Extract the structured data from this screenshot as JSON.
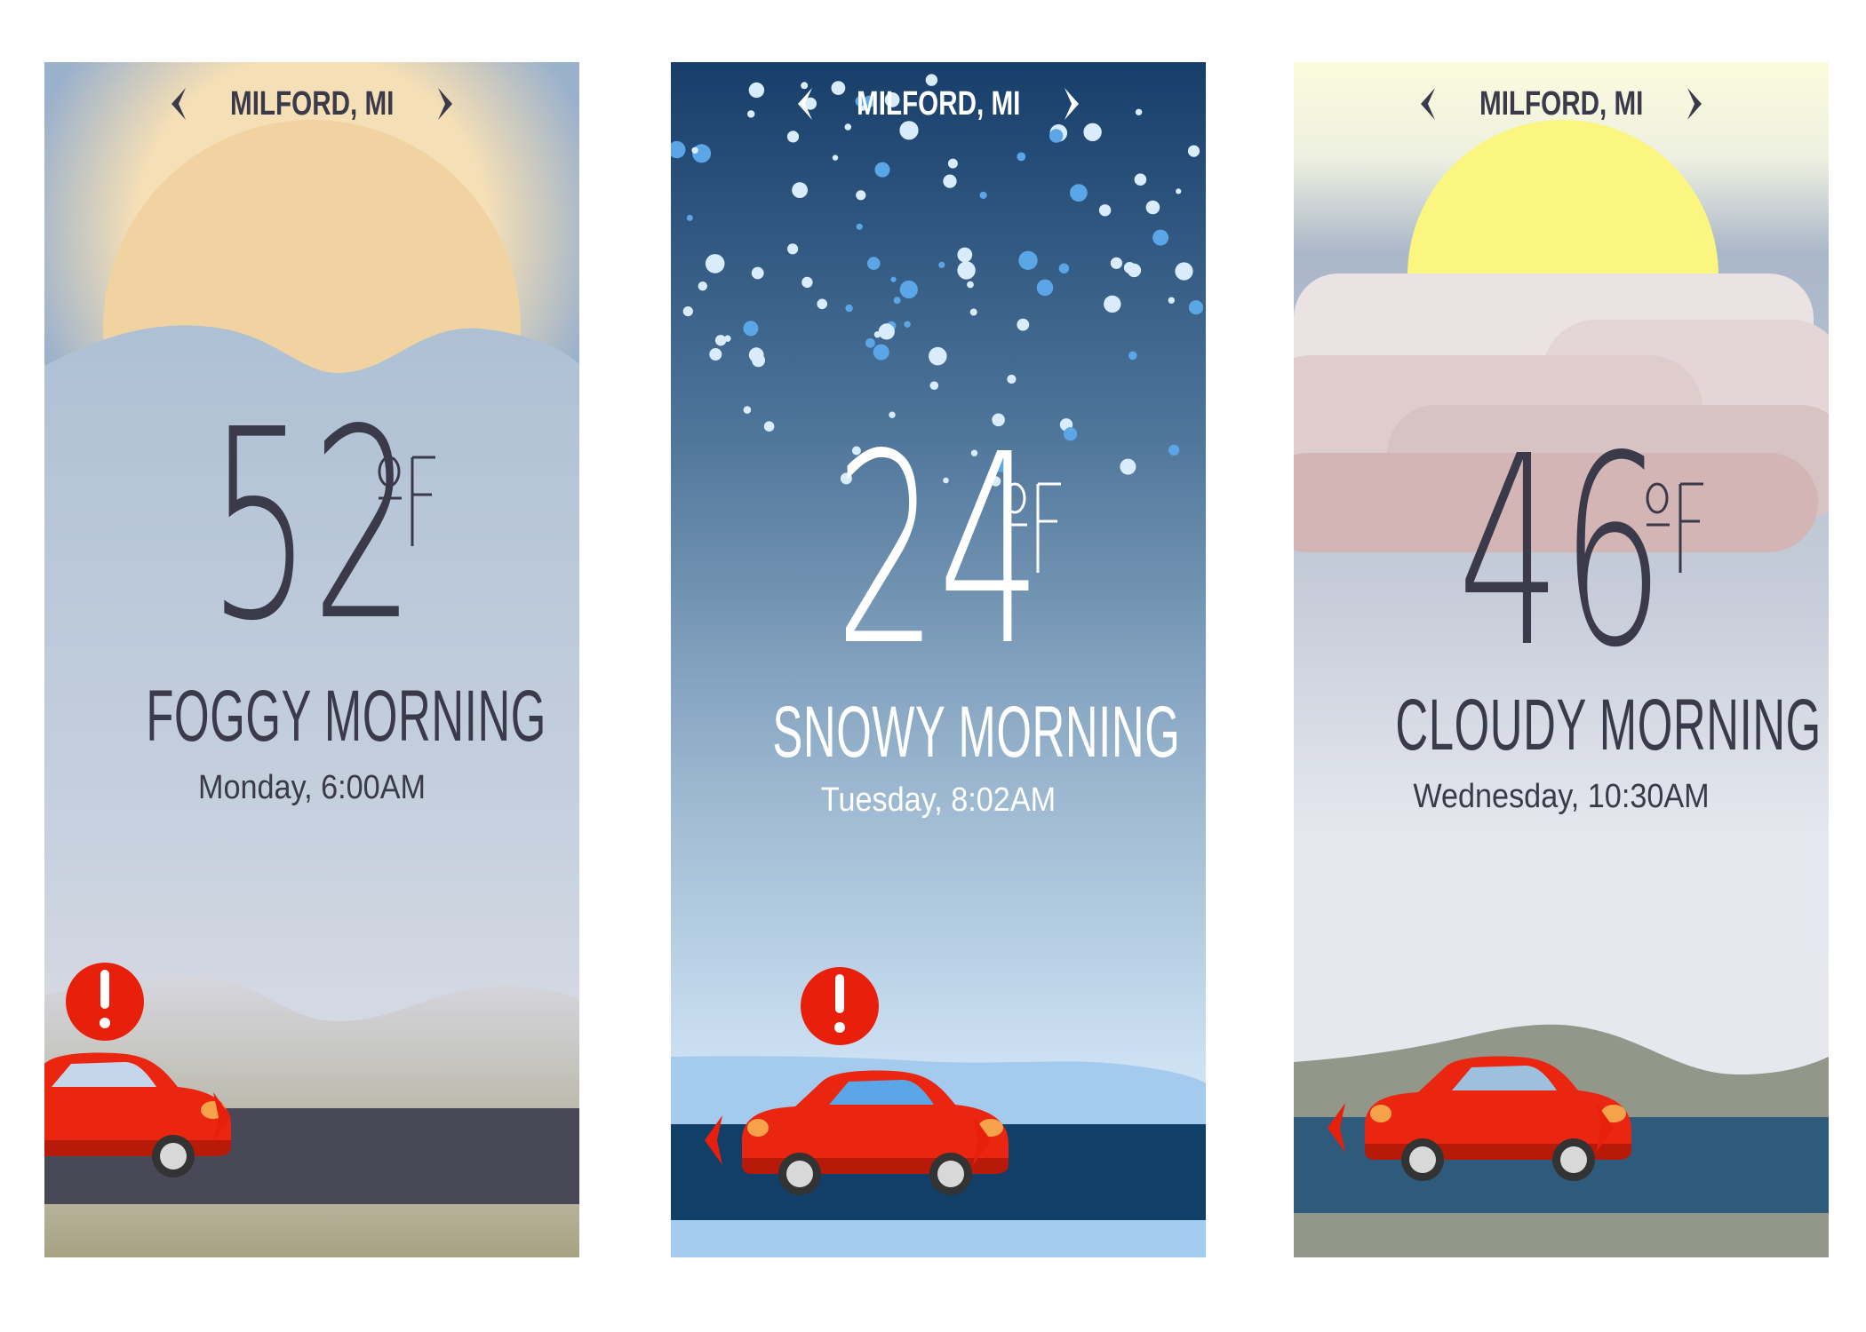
{
  "panels": [
    {
      "location": "MILFORD, MI",
      "temperature": "52",
      "unit": "°F",
      "condition": "FOGGY MORNING",
      "datetime": "Monday, 6:00AM",
      "alert": true,
      "colors": {
        "text": "#3a3a4a",
        "sky_top": "#93abc8",
        "sun": "#f2d29a",
        "road": "#484856"
      }
    },
    {
      "location": "MILFORD, MI",
      "temperature": "24",
      "unit": "°F",
      "condition": "SNOWY MORNING",
      "datetime": "Tuesday, 8:02AM",
      "alert": true,
      "colors": {
        "text": "#ffffff",
        "sky_top": "#173e6a",
        "sky_bottom": "#c9e2f5",
        "road": "#113f68"
      }
    },
    {
      "location": "MILFORD, MI",
      "temperature": "46",
      "unit": "°F",
      "condition": "CLOUDY MORNING",
      "datetime": "Wednesday, 10:30AM",
      "alert": false,
      "colors": {
        "text": "#3a3a4a",
        "sun": "#fbf67f",
        "hill": "#93978a",
        "road": "#2e5a7c"
      }
    }
  ],
  "icons": [
    "chevron-left-icon",
    "chevron-right-icon",
    "alert-icon",
    "car-icon"
  ]
}
